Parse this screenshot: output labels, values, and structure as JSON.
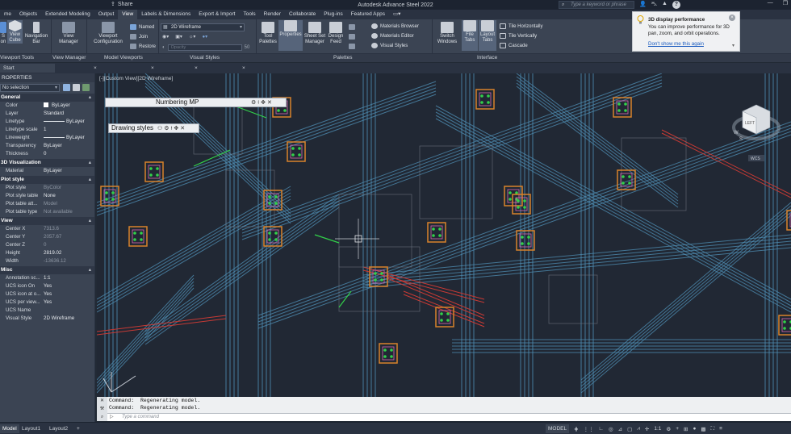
{
  "app": {
    "title": "Autodesk Advance Steel 2022",
    "share_label": "Share",
    "search_placeholder": "Type a keyword or phrase"
  },
  "ribbon_tabs": [
    "me",
    "Objects",
    "Extended Modeling",
    "Output",
    "View",
    "Labels & Dimensions",
    "Export & Import",
    "Tools",
    "Render",
    "Collaborate",
    "Plug-ins",
    "Featured Apps"
  ],
  "active_ribbon_tab": "View",
  "ribbon": {
    "ucs_icon_label": "S\non",
    "view_cube_label": "View\nCube",
    "nav_bar_label": "Navigation\nBar",
    "view_manager_label": "View\nManager",
    "viewport_config_label": "Viewport\nConfiguration",
    "named_label": "Named",
    "join_label": "Join",
    "restore_label": "Restore",
    "visual_style_value": "2D Wireframe",
    "opacity_placeholder": "Opacity",
    "opacity_value": "50",
    "tool_palettes_label": "Tool\nPalettes",
    "properties_label": "Properties",
    "sheet_set_label": "Sheet Set\nManager",
    "design_feed_label": "Design\nFeed",
    "materials_browser_label": "Materials Browser",
    "materials_editor_label": "Materials Editor",
    "visual_styles_label": "Visual Styles",
    "switch_windows_label": "Switch\nWindows",
    "file_tabs_label": "File\nTabs",
    "layout_tabs_label": "Layout\nTabs",
    "tile_h_label": "Tile Horizontally",
    "tile_v_label": "Tile Vertically",
    "cascade_label": "Cascade"
  },
  "panel_labels": {
    "viewport_tools": "Viewport Tools",
    "view_manager": "View Manager",
    "model_viewports": "Model Viewports",
    "visual_styles": "Visual Styles",
    "palettes": "Palettes",
    "interface": "Interface"
  },
  "notification": {
    "title": "3D display performance",
    "body": "You can improve performance for 3D pan, zoom, and orbit operations.",
    "link": "Don't show me this again"
  },
  "doc_tabs": [
    "Start",
    "",
    "",
    "",
    ""
  ],
  "properties": {
    "title": "ROPERTIES",
    "selection": "No selection",
    "sections": [
      {
        "name": "General",
        "rows": [
          {
            "k": "Color",
            "v": "ByLayer"
          },
          {
            "k": "Layer",
            "v": "Standard"
          },
          {
            "k": "Linetype",
            "v": "ByLayer"
          },
          {
            "k": "Linetype scale",
            "v": "1"
          },
          {
            "k": "Lineweight",
            "v": "ByLayer"
          },
          {
            "k": "Transparency",
            "v": "ByLayer"
          },
          {
            "k": "Thickness",
            "v": "0"
          }
        ]
      },
      {
        "name": "3D Visualization",
        "rows": [
          {
            "k": "Material",
            "v": "ByLayer"
          }
        ]
      },
      {
        "name": "Plot style",
        "rows": [
          {
            "k": "Plot style",
            "v": "ByColor"
          },
          {
            "k": "Plot style table",
            "v": "None"
          },
          {
            "k": "Plot table att...",
            "v": "Model"
          },
          {
            "k": "Plot table type",
            "v": "Not available"
          }
        ]
      },
      {
        "name": "View",
        "rows": [
          {
            "k": "Center X",
            "v": "7313.6"
          },
          {
            "k": "Center Y",
            "v": "2057.67"
          },
          {
            "k": "Center Z",
            "v": "0"
          },
          {
            "k": "Height",
            "v": "2819.02"
          },
          {
            "k": "Width",
            "v": "-13636.12"
          }
        ]
      },
      {
        "name": "Misc",
        "rows": [
          {
            "k": "Annotation sc...",
            "v": "1:1"
          },
          {
            "k": "UCS icon On",
            "v": "Yes"
          },
          {
            "k": "UCS icon at o...",
            "v": "Yes"
          },
          {
            "k": "UCS per view...",
            "v": "Yes"
          },
          {
            "k": "UCS Name",
            "v": ""
          },
          {
            "k": "Visual Style",
            "v": "2D Wireframe"
          }
        ]
      }
    ]
  },
  "viewport": {
    "label": "[-][Custom View][2D Wireframe]",
    "numbering_palette": "Numbering MP",
    "drawing_styles_palette": "Drawing styles",
    "viewcube_face": "LEFT",
    "compass_w": "W",
    "compass_s": "S",
    "wcs_label": "WCS"
  },
  "command": {
    "history": [
      "Command:  Regenerating model.",
      "Command:  Regenerating model."
    ],
    "placeholder": "Type a command"
  },
  "status": {
    "tabs": [
      "Model",
      "Layout1",
      "Layout2"
    ],
    "model_label": "MODEL",
    "scale": "1:1"
  },
  "colors": {
    "steel_blue": "#4f8fb5",
    "beam_red": "#c83a34",
    "plate_orange": "#d9822b",
    "bolt_green": "#32d14a",
    "pink_detail": "#d66ab0"
  }
}
